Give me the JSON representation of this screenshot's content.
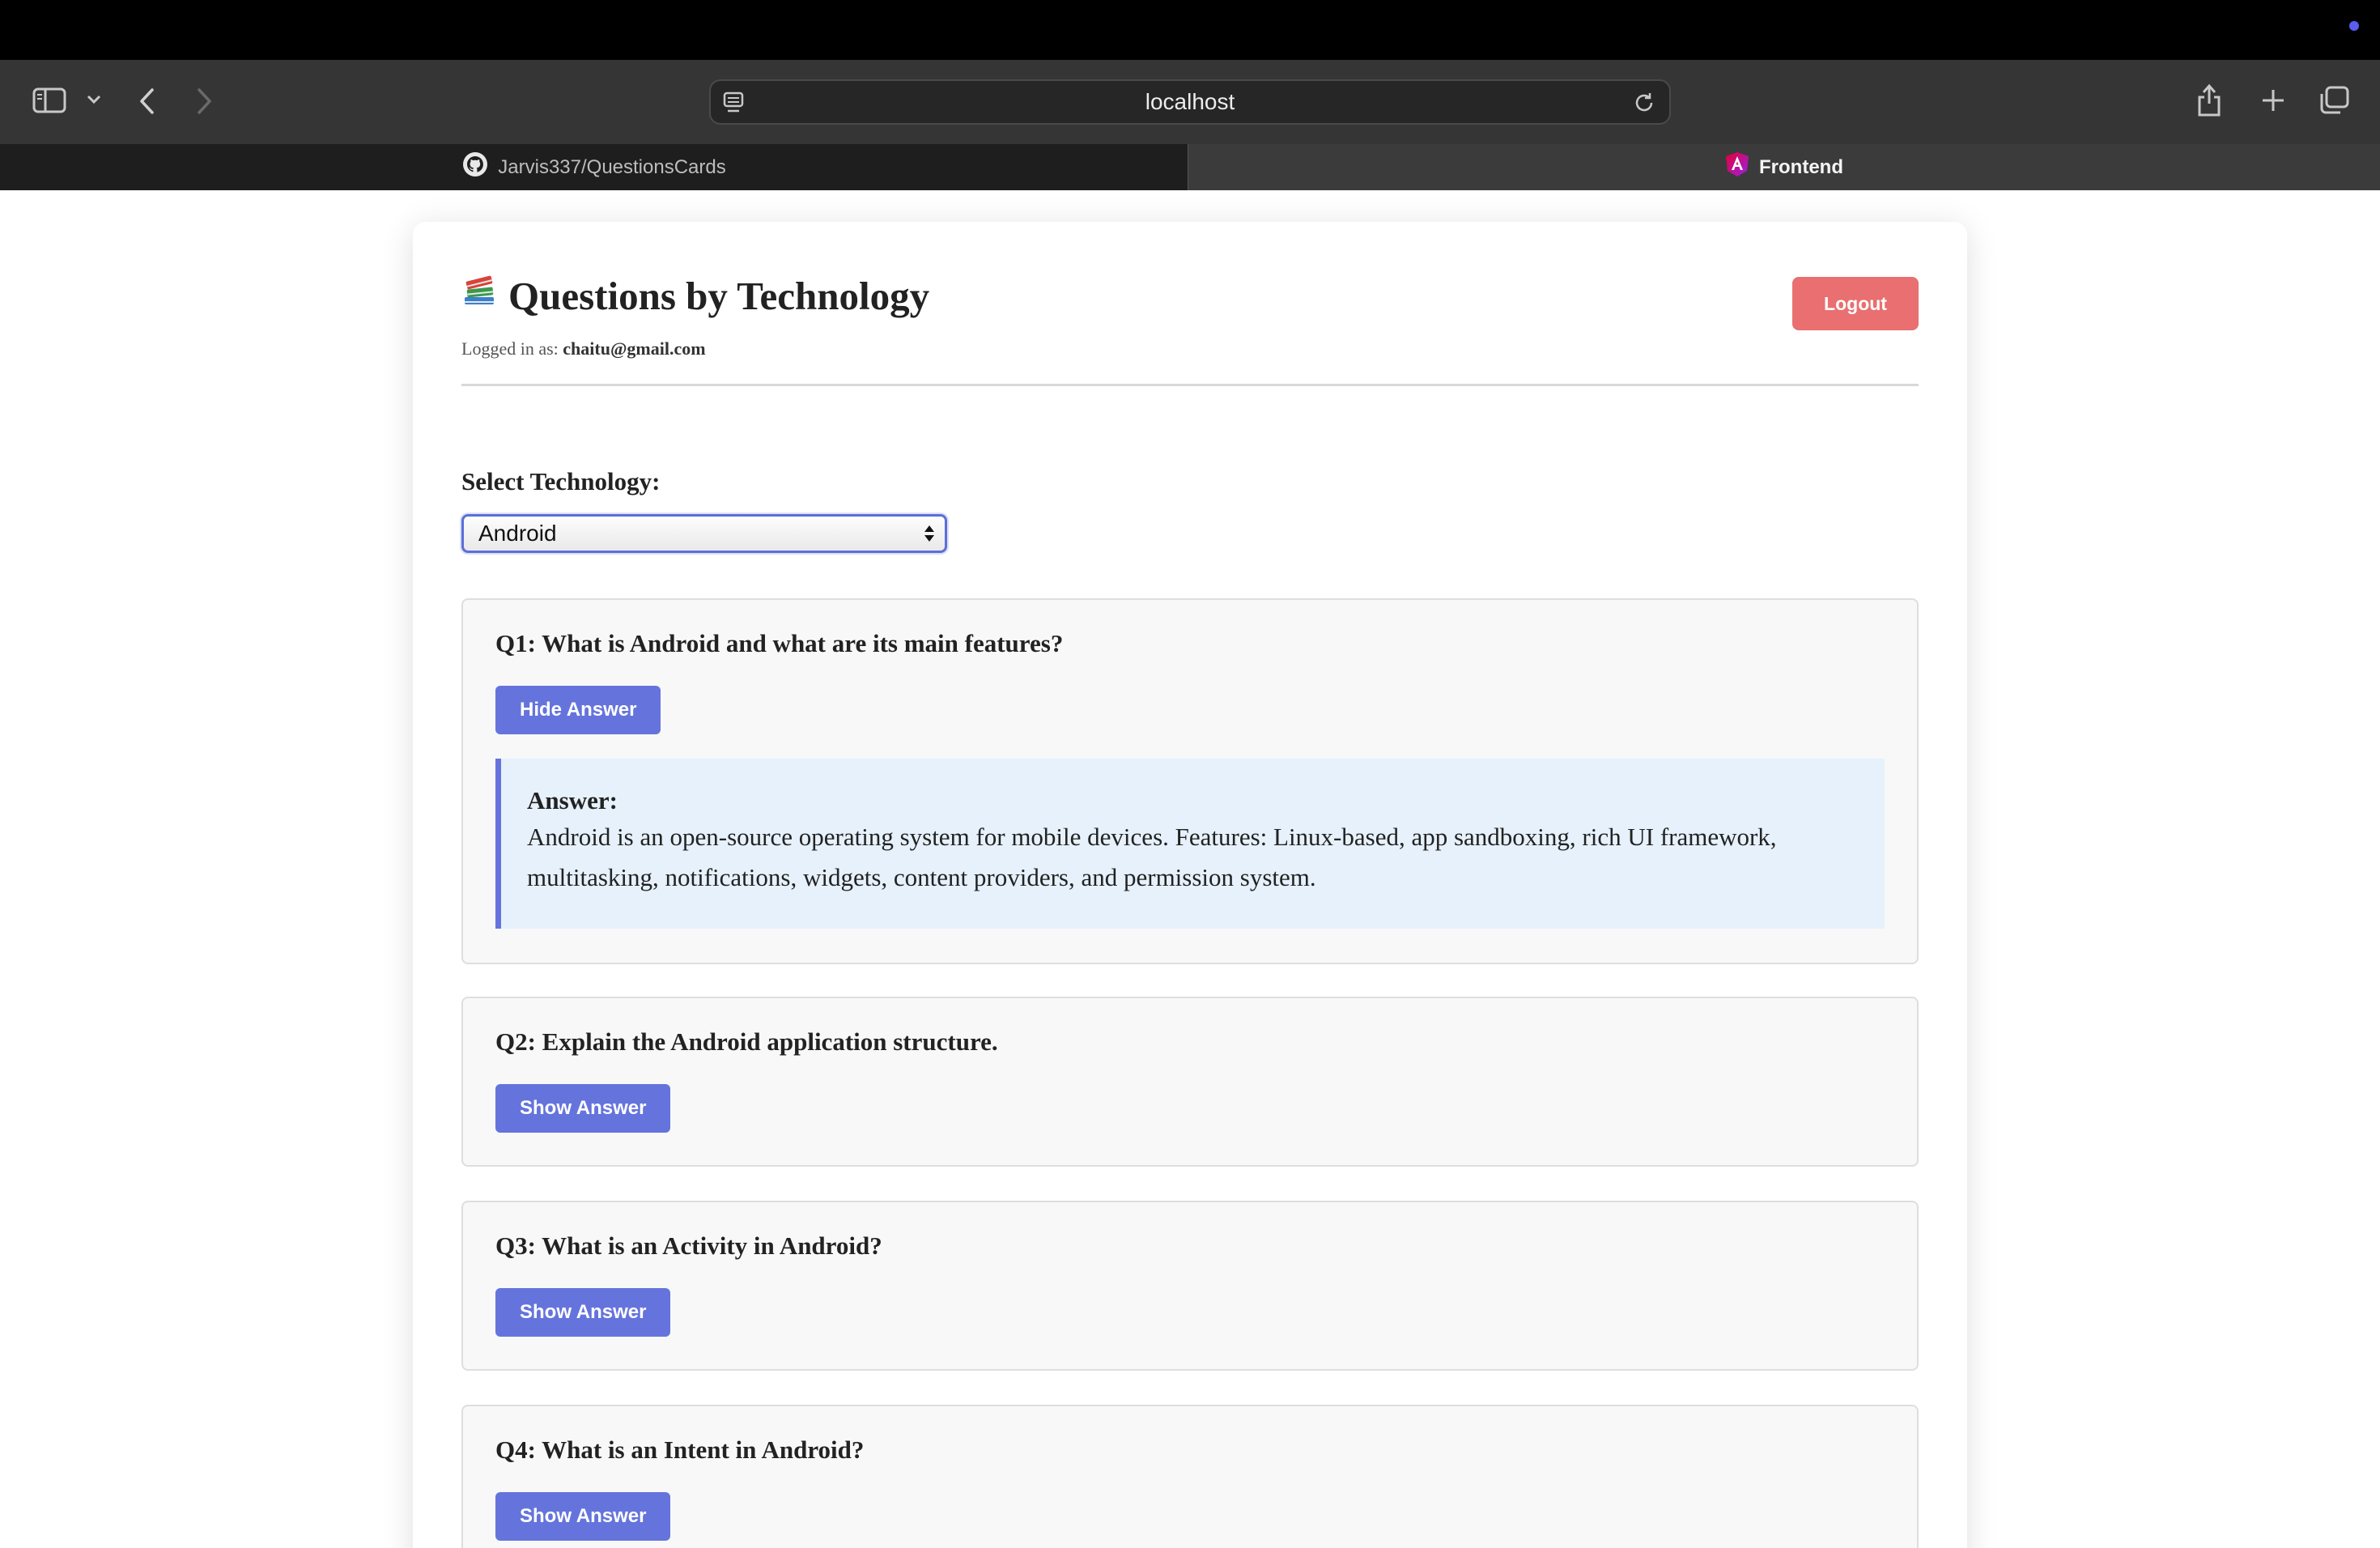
{
  "browser": {
    "url": "localhost",
    "tabs": [
      {
        "label": "Jarvis337/QuestionsCards",
        "icon": "github-icon"
      },
      {
        "label": "Frontend",
        "icon": "angular-icon"
      }
    ]
  },
  "header": {
    "title": "Questions by Technology",
    "title_icon": "books-icon",
    "logged_in_prefix": "Logged in as:",
    "user_email": "chaitu@gmail.com",
    "logout_label": "Logout"
  },
  "technology": {
    "label": "Select Technology:",
    "selected": "Android"
  },
  "questions": [
    {
      "title": "Q1: What is Android and what are its main features?",
      "button": "Hide Answer",
      "answer_label": "Answer:",
      "answer": "Android is an open-source operating system for mobile devices. Features: Linux-based, app sandboxing, rich UI framework, multitasking, notifications, widgets, content providers, and permission system."
    },
    {
      "title": "Q2: Explain the Android application structure.",
      "button": "Show Answer"
    },
    {
      "title": "Q3: What is an Activity in Android?",
      "button": "Show Answer"
    },
    {
      "title": "Q4: What is an Intent in Android?",
      "button": "Show Answer"
    }
  ],
  "colors": {
    "primary": "#6574dc",
    "logout": "#e96f70",
    "answer_bg": "#e6f1fb"
  }
}
